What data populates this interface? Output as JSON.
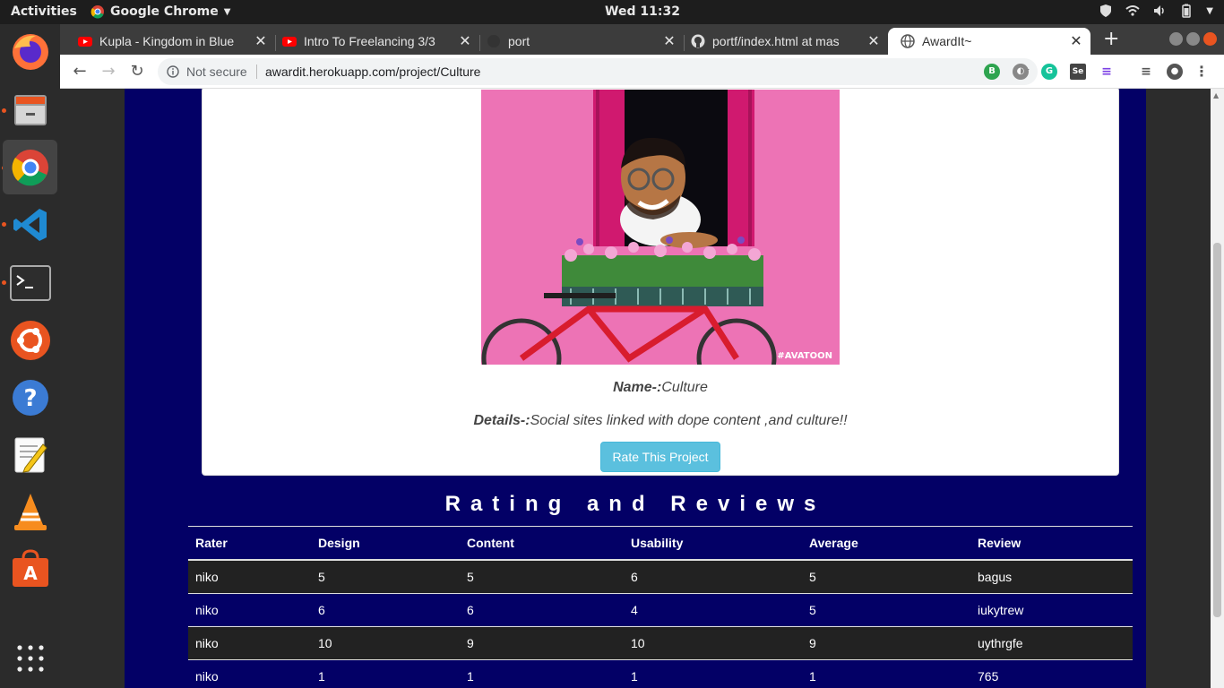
{
  "system": {
    "activities": "Activities",
    "app_name": "Google Chrome",
    "clock": "Wed 11:32"
  },
  "dock": {
    "items": [
      "firefox-icon",
      "files-icon",
      "chrome-icon",
      "vscode-icon",
      "terminal-icon",
      "ubuntu-software-icon",
      "help-icon",
      "text-editor-icon",
      "vlc-icon",
      "app-store-icon",
      "show-apps-icon"
    ]
  },
  "tabs": [
    {
      "title": "Kupla - Kingdom in Blue",
      "icon": "youtube-icon"
    },
    {
      "title": "Intro To Freelancing 3/3",
      "icon": "youtube-icon"
    },
    {
      "title": "port",
      "icon": "loading-icon"
    },
    {
      "title": "portf/index.html at mas",
      "icon": "github-icon"
    },
    {
      "title": "AwardIt~",
      "icon": "globe-icon"
    }
  ],
  "omnibox": {
    "security": "Not secure",
    "url": "awardit.herokuapp.com/project/Culture"
  },
  "project": {
    "name_label": "Name-:",
    "name_value": "Culture",
    "details_label": "Details-:",
    "details_value": "Social sites linked with dope content ,and culture!!",
    "watermark": "#AVATOON",
    "rate_button": "Rate This Project"
  },
  "reviews": {
    "heading": "Rating and Reviews",
    "columns": [
      "Rater",
      "Design",
      "Content",
      "Usability",
      "Average",
      "Review"
    ],
    "rows": [
      [
        "niko",
        "5",
        "5",
        "6",
        "5",
        "bagus"
      ],
      [
        "niko",
        "6",
        "6",
        "4",
        "5",
        "iukytrew"
      ],
      [
        "niko",
        "10",
        "9",
        "10",
        "9",
        "uythrgfe"
      ],
      [
        "niko",
        "1",
        "1",
        "1",
        "1",
        "765"
      ]
    ]
  },
  "colors": {
    "page_bg": "#030066",
    "button": "#5bc0de",
    "row_dark": "#222222"
  }
}
